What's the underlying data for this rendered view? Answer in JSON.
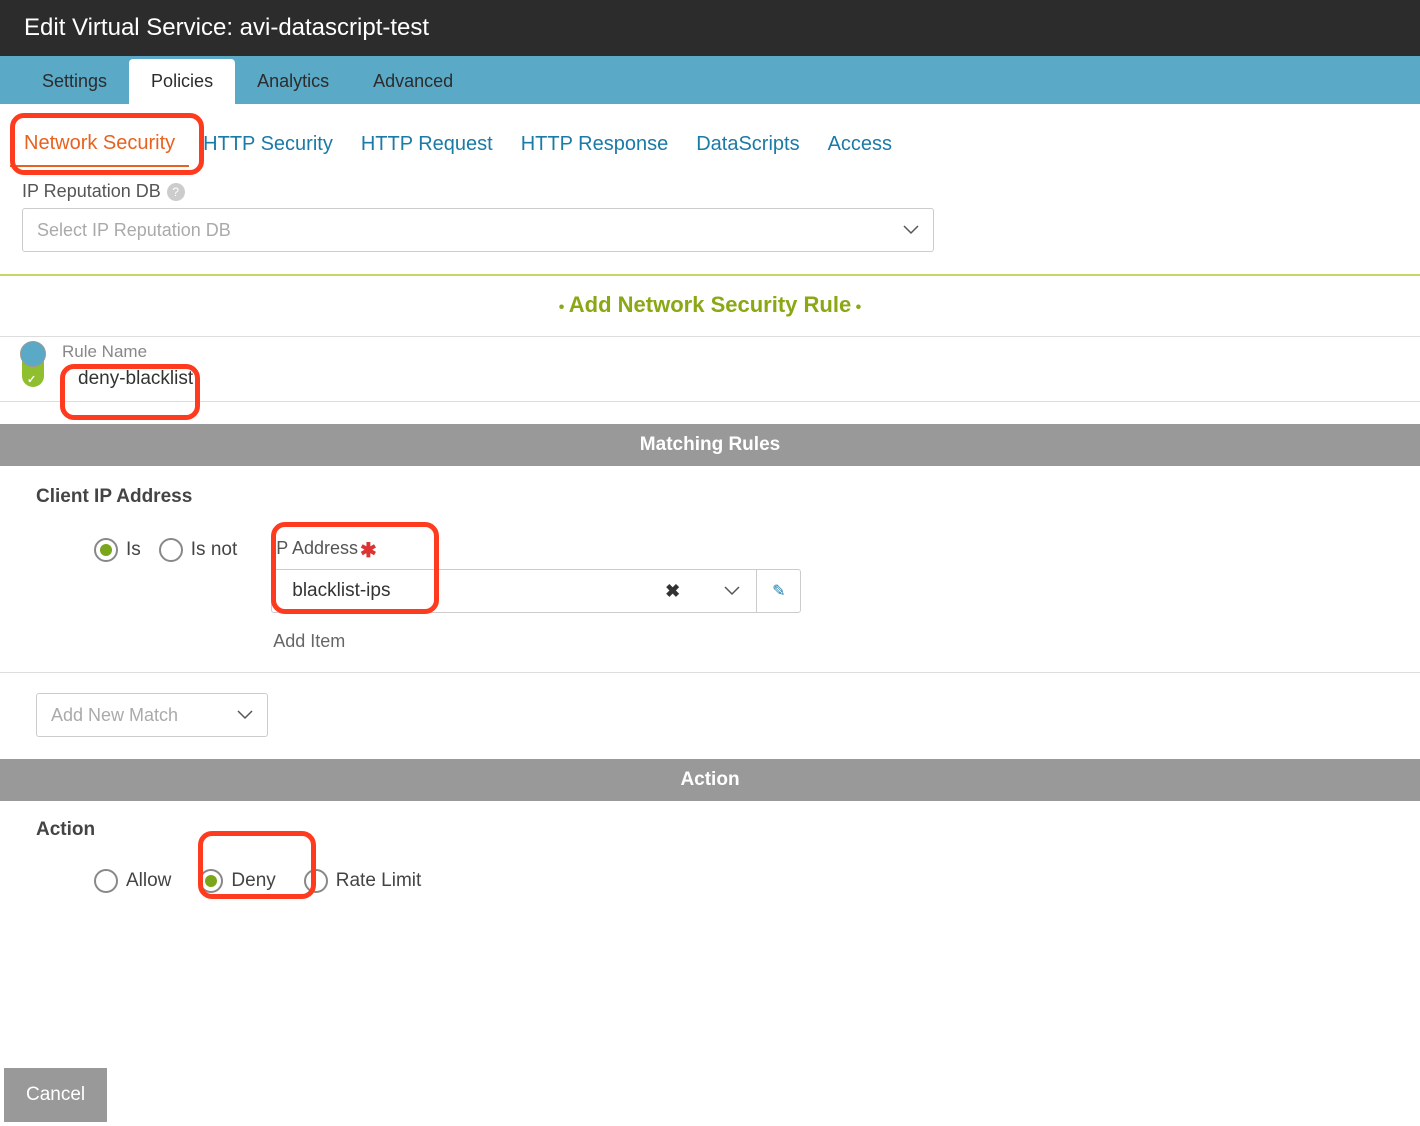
{
  "header": {
    "title": "Edit Virtual Service: avi-datascript-test"
  },
  "tabs": [
    "Settings",
    "Policies",
    "Analytics",
    "Advanced"
  ],
  "subtabs": [
    "Network Security",
    "HTTP Security",
    "HTTP Request",
    "HTTP Response",
    "DataScripts",
    "Access"
  ],
  "ip_rep": {
    "label": "IP Reputation DB",
    "placeholder": "Select IP Reputation DB"
  },
  "add_rule": {
    "text": "Add Network Security Rule"
  },
  "rule": {
    "name_label": "Rule Name",
    "name_value": "deny-blacklist"
  },
  "bands": {
    "matching": "Matching Rules",
    "action": "Action"
  },
  "matching": {
    "title": "Client IP Address",
    "radio_is": "Is",
    "radio_isnot": "Is not",
    "ip_label": "IP Address",
    "ip_value": "blacklist-ips",
    "add_item": "Add Item",
    "add_match_placeholder": "Add New Match"
  },
  "action": {
    "label": "Action",
    "allow": "Allow",
    "deny": "Deny",
    "rate_limit": "Rate Limit"
  },
  "footer": {
    "cancel": "Cancel"
  }
}
